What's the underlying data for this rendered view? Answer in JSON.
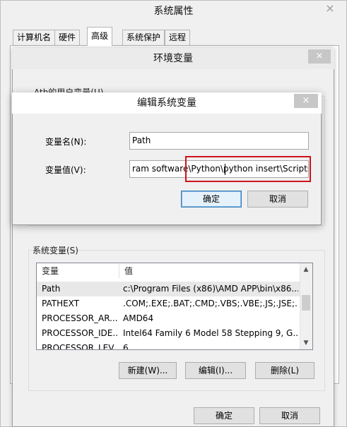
{
  "system_properties": {
    "title": "系统属性",
    "close_icon": "×",
    "tabs": [
      {
        "label": "计算机名"
      },
      {
        "label": "硬件"
      },
      {
        "label": "高级"
      },
      {
        "label": "系统保护"
      },
      {
        "label": "远程"
      }
    ],
    "active_tab": "高级"
  },
  "environment_variables": {
    "title": "环境变量",
    "close_icon": "×",
    "user_variables_label": "Ath的用户变量(U)",
    "system_variables_label": "系统变量(S)",
    "system_variables": {
      "columns": [
        "变量",
        "值"
      ],
      "rows": [
        {
          "name": "Path",
          "value": "c:\\Program Files (x86)\\AMD APP\\bin\\x86..."
        },
        {
          "name": "PATHEXT",
          "value": ".COM;.EXE;.BAT;.CMD;.VBS;.VBE;.JS;.JSE;..."
        },
        {
          "name": "PROCESSOR_AR...",
          "value": "AMD64"
        },
        {
          "name": "PROCESSOR_IDE...",
          "value": "Intel64 Family 6 Model 58 Stepping 9, G..."
        },
        {
          "name": "PROCESSOR_LEV...",
          "value": "6"
        }
      ],
      "selected_row": "Path",
      "scroll_up_icon": "▲",
      "scroll_down_icon": "▼"
    },
    "buttons": {
      "new": "新建(W)...",
      "edit": "编辑(I)...",
      "delete": "删除(L)"
    },
    "ok": "确定",
    "cancel": "取消"
  },
  "edit_system_variable": {
    "title": "编辑系统变量",
    "close_icon": "×",
    "name_label": "变量名(N):",
    "name_value": "Path",
    "value_label": "变量值(V):",
    "value_value": "ram software\\Python\\python insert\\Scripts",
    "ok": "确定",
    "cancel": "取消"
  },
  "colors": {
    "highlight_box": "#d0131d",
    "close_button": "#c7c7c7",
    "default_button_border": "#3c7fb1"
  }
}
